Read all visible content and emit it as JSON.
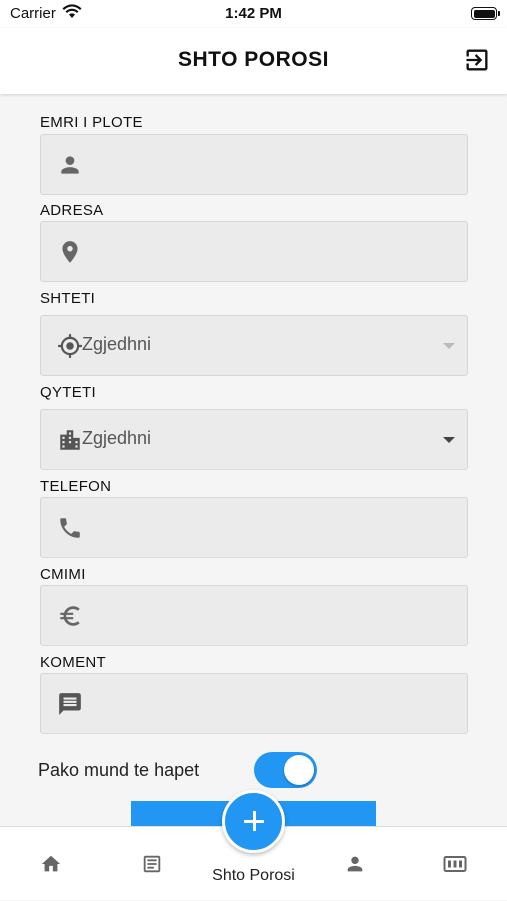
{
  "status_bar": {
    "carrier": "Carrier",
    "time": "1:42 PM"
  },
  "header": {
    "title": "SHTO POROSI",
    "logout_icon": "logout-icon"
  },
  "form": {
    "fields": [
      {
        "label": "EMRI I PLOTE",
        "icon": "person-icon",
        "value": ""
      },
      {
        "label": "ADRESA",
        "icon": "location-pin-icon",
        "value": ""
      },
      {
        "label": "SHTETI",
        "icon": "crosshair-icon",
        "value": "Zgjedhni"
      },
      {
        "label": "QYTETI",
        "icon": "city-icon",
        "value": "Zgjedhni"
      },
      {
        "label": "TELEFON",
        "icon": "phone-icon",
        "value": ""
      },
      {
        "label": "CMIMI",
        "icon": "euro-icon",
        "value": ""
      },
      {
        "label": "KOMENT",
        "icon": "comment-icon",
        "value": ""
      }
    ],
    "toggle": {
      "label": "Pako mund te hapet",
      "on": true
    }
  },
  "tab_bar": {
    "center_label": "Shto Porosi",
    "tabs": [
      "home-icon",
      "list-icon",
      "add-icon",
      "profile-icon",
      "counter-icon"
    ]
  },
  "colors": {
    "accent": "#2196f3",
    "field_bg": "#ebebeb"
  }
}
